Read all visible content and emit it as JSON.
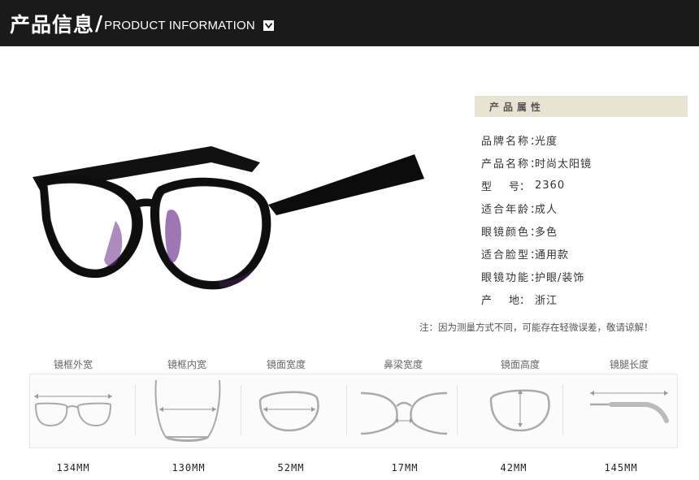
{
  "header": {
    "title_zh": "产品信息",
    "slash": "/",
    "title_en": "PRODUCT INFORMATION"
  },
  "icons": [
    "chevron-down-icon",
    "glasses-product-photo",
    "frame-width-icon",
    "frame-inner-width-icon",
    "lens-width-icon",
    "bridge-width-icon",
    "lens-height-icon",
    "temple-length-icon"
  ],
  "attributes": {
    "heading": "产品属性",
    "rows": [
      {
        "key": "品牌名称：",
        "value": "光度"
      },
      {
        "key": "产品名称：",
        "value": "时尚太阳镜"
      },
      {
        "key_a": "型",
        "key_b": "号：",
        "value": "2360"
      },
      {
        "key": "适合年龄：",
        "value": "成人"
      },
      {
        "key": "眼镜颜色：",
        "value": "多色"
      },
      {
        "key": "适合脸型：",
        "value": "通用款"
      },
      {
        "key": "眼镜功能：",
        "value": "护眼/装饰"
      },
      {
        "key_a": "产",
        "key_b": "地：",
        "value": "浙江"
      }
    ]
  },
  "note": "注：因为测量方式不同，可能存在轻微误差，敬请谅解！",
  "measurements": [
    {
      "label": "镜框外宽",
      "value": "134MM"
    },
    {
      "label": "镜框内宽",
      "value": "130MM"
    },
    {
      "label": "镜面宽度",
      "value": "52MM"
    },
    {
      "label": "鼻梁宽度",
      "value": "17MM"
    },
    {
      "label": "镜面高度",
      "value": "42MM"
    },
    {
      "label": "镜腿长度",
      "value": "145MM"
    }
  ],
  "colors": {
    "header_bg": "#1a1a1a",
    "attr_head_bg": "#e9e3d4",
    "frame": "#111111",
    "lens_tint": "#6a2c8a"
  }
}
